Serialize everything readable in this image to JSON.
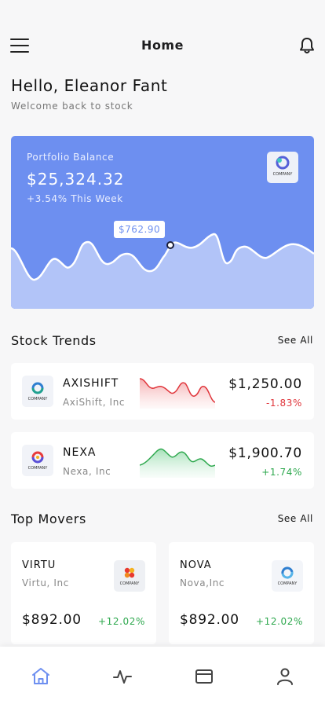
{
  "header": {
    "title": "Home",
    "menu_icon": "hamburger-menu-icon",
    "bell_icon": "bell-icon"
  },
  "greeting": {
    "title": "Hello, Eleanor Fant",
    "subtitle": "Welcome back to stock"
  },
  "portfolio": {
    "label": "Portfolio Balance",
    "balance": "$25,324.32",
    "change": "+3.54% This Week",
    "tooltip": "$762.90",
    "logo_text": "COMPANY",
    "background_color": "#6d8ff0"
  },
  "stock_trends": {
    "title": "Stock Trends",
    "see_all": "See All",
    "items": [
      {
        "ticker": "AXISHIFT",
        "name": "AxiShift, Inc",
        "price": "$1,250.00",
        "change": "-1.83%",
        "logo_text": "COMPANY",
        "color": "#e0353b"
      },
      {
        "ticker": "NEXA",
        "name": "Nexa, Inc",
        "price": "$1,900.70",
        "change": "+1.74%",
        "logo_text": "COMPANY",
        "color": "#2ea84e"
      }
    ]
  },
  "top_movers": {
    "title": "Top Movers",
    "see_all": "See All",
    "items": [
      {
        "ticker": "VIRTU",
        "name": "Virtu, Inc",
        "price": "$892.00",
        "change": "+12.02%",
        "logo_text": "COMPANY"
      },
      {
        "ticker": "NOVA",
        "name": "Nova,Inc",
        "price": "$892.00",
        "change": "+12.02%",
        "logo_text": "COMPANY"
      }
    ]
  },
  "bottom_nav": {
    "items": [
      {
        "icon": "home-icon",
        "active": true
      },
      {
        "icon": "activity-icon",
        "active": false
      },
      {
        "icon": "wallet-icon",
        "active": false
      },
      {
        "icon": "profile-icon",
        "active": false
      }
    ],
    "active_color": "#6d8ff0"
  }
}
